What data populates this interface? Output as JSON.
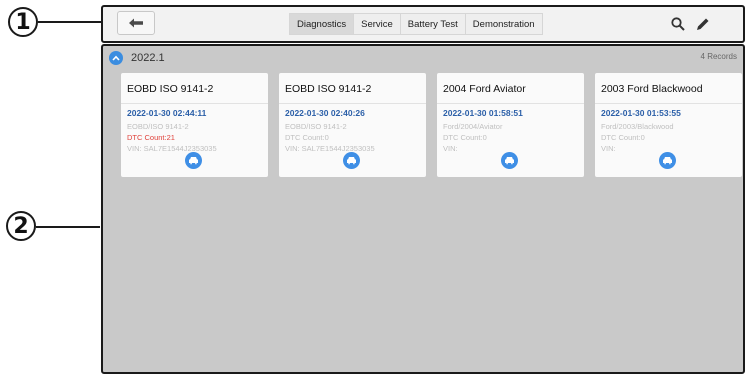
{
  "callouts": {
    "one": "1",
    "two": "2"
  },
  "toolbar": {
    "tabs": [
      {
        "label": "Diagnostics",
        "active": true
      },
      {
        "label": "Service",
        "active": false
      },
      {
        "label": "Battery Test",
        "active": false
      },
      {
        "label": "Demonstration",
        "active": false
      }
    ],
    "icons": [
      "back-arrow-icon",
      "search-icon",
      "edit-icon"
    ]
  },
  "group": {
    "title": "2022.1",
    "records": "4 Records"
  },
  "cards": [
    {
      "title": "EOBD ISO 9141-2",
      "date": "2022-01-30 02:44:11",
      "path": "EOBD/ISO 9141-2",
      "dtc": "DTC Count:21",
      "vin": "VIN: SAL7E1544J2353035"
    },
    {
      "title": "EOBD ISO 9141-2",
      "date": "2022-01-30 02:40:26",
      "path": "EOBD/ISO 9141-2",
      "dtc": "DTC Count:0",
      "vin": "VIN: SAL7E1544J2353035"
    },
    {
      "title": "2004 Ford Aviator",
      "date": "2022-01-30 01:58:51",
      "path": "Ford/2004/Aviator",
      "dtc": "DTC Count:0",
      "vin": "VIN:"
    },
    {
      "title": "2003 Ford Blackwood",
      "date": "2022-01-30 01:53:55",
      "path": "Ford/2003/Blackwood",
      "dtc": "DTC Count:0",
      "vin": "VIN:"
    }
  ],
  "colors": {
    "accent": "#3b8de0",
    "date_blue": "#2b5fa8",
    "dtc_red": "#e0433c",
    "panel_gray": "#c9c9c9"
  }
}
